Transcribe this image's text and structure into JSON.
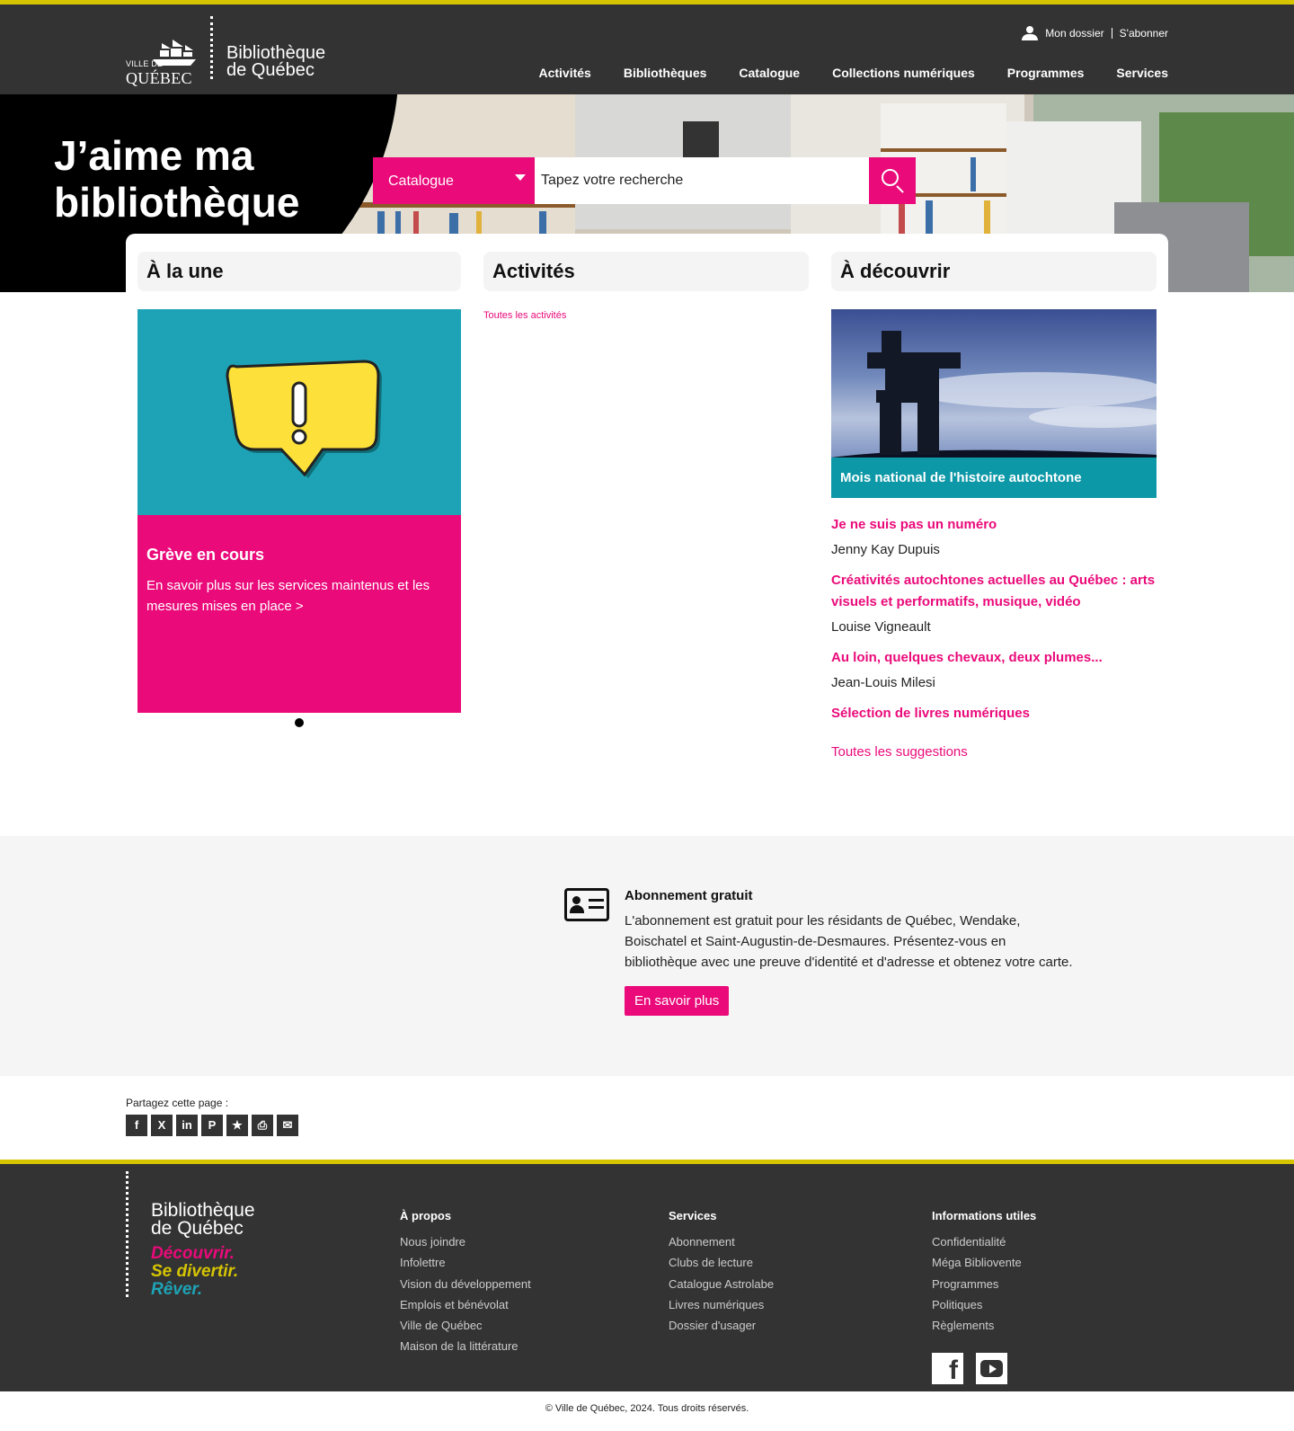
{
  "header": {
    "logo": {
      "ville": "VILLE DE",
      "quebec": "QUÉBEC",
      "line1": "Bibliothèque",
      "line2": "de Québec"
    },
    "util": {
      "account": "Mon dossier",
      "subscribe": "S'abonner"
    },
    "nav": [
      "Activités",
      "Bibliothèques",
      "Catalogue",
      "Collections numériques",
      "Programmes",
      "Services"
    ]
  },
  "hero": {
    "title_line1": "J’aime ma",
    "title_line2": "bibliothèque",
    "search": {
      "scope": "Catalogue",
      "placeholder": "Tapez votre recherche"
    }
  },
  "sections": {
    "une": {
      "title": "À la une",
      "slide_title": "Grève en cours",
      "slide_text": "En savoir plus sur les services maintenus et les mesures mises en place >"
    },
    "activites": {
      "title": "Activités",
      "link": "Toutes les activités"
    },
    "decouvrir": {
      "title": "À découvrir",
      "caption": "Mois national de l'histoire autochtone",
      "items": [
        {
          "title": "Je ne suis pas un numéro",
          "author": "Jenny Kay Dupuis"
        },
        {
          "title": "Créativités autochtones actuelles au Québec : arts visuels et performatifs, musique, vidéo",
          "author": "Louise Vigneault"
        },
        {
          "title": "Au loin, quelques chevaux, deux plumes...",
          "author": "Jean-Louis Milesi"
        },
        {
          "title": "Sélection de livres numériques",
          "author": ""
        }
      ],
      "all_link": "Toutes les suggestions"
    }
  },
  "abonnement": {
    "title": "Abonnement gratuit",
    "text": "L'abonnement est gratuit pour les résidants de Québec, Wendake, Boischatel et Saint-Augustin-de-Desmaures. Présentez-vous en bibliothèque avec une preuve d'identité et d'adresse et obtenez votre carte.",
    "button": "En savoir plus"
  },
  "share": {
    "label": "Partagez cette page :",
    "icons": [
      "facebook-icon",
      "x-icon",
      "linkedin-icon",
      "pinterest-icon",
      "bookmark-icon",
      "print-icon",
      "email-icon"
    ]
  },
  "footer": {
    "logo_line1": "Bibliothèque",
    "logo_line2": "de Québec",
    "tagline": [
      "Découvrir.",
      "Se divertir.",
      "Rêver."
    ],
    "columns": [
      {
        "title": "À propos",
        "links": [
          "Nous joindre",
          "Infolettre",
          "Vision du développement",
          "Emplois et bénévolat",
          "Ville de Québec",
          "Maison de la littérature"
        ]
      },
      {
        "title": "Services",
        "links": [
          "Abonnement",
          "Clubs de lecture",
          "Catalogue Astrolabe",
          "Livres numériques",
          "Dossier d'usager"
        ]
      },
      {
        "title": "Informations utiles",
        "links": [
          "Confidentialité",
          "Méga Bibliovente",
          "Programmes",
          "Politiques",
          "Règlements"
        ]
      }
    ],
    "copyright": "© Ville de Québec, 2024. Tous droits réservés."
  },
  "colors": {
    "accent": "#ea0a7a",
    "yellow": "#d6c400",
    "teal": "#1ea3b6",
    "dark": "#333333"
  }
}
